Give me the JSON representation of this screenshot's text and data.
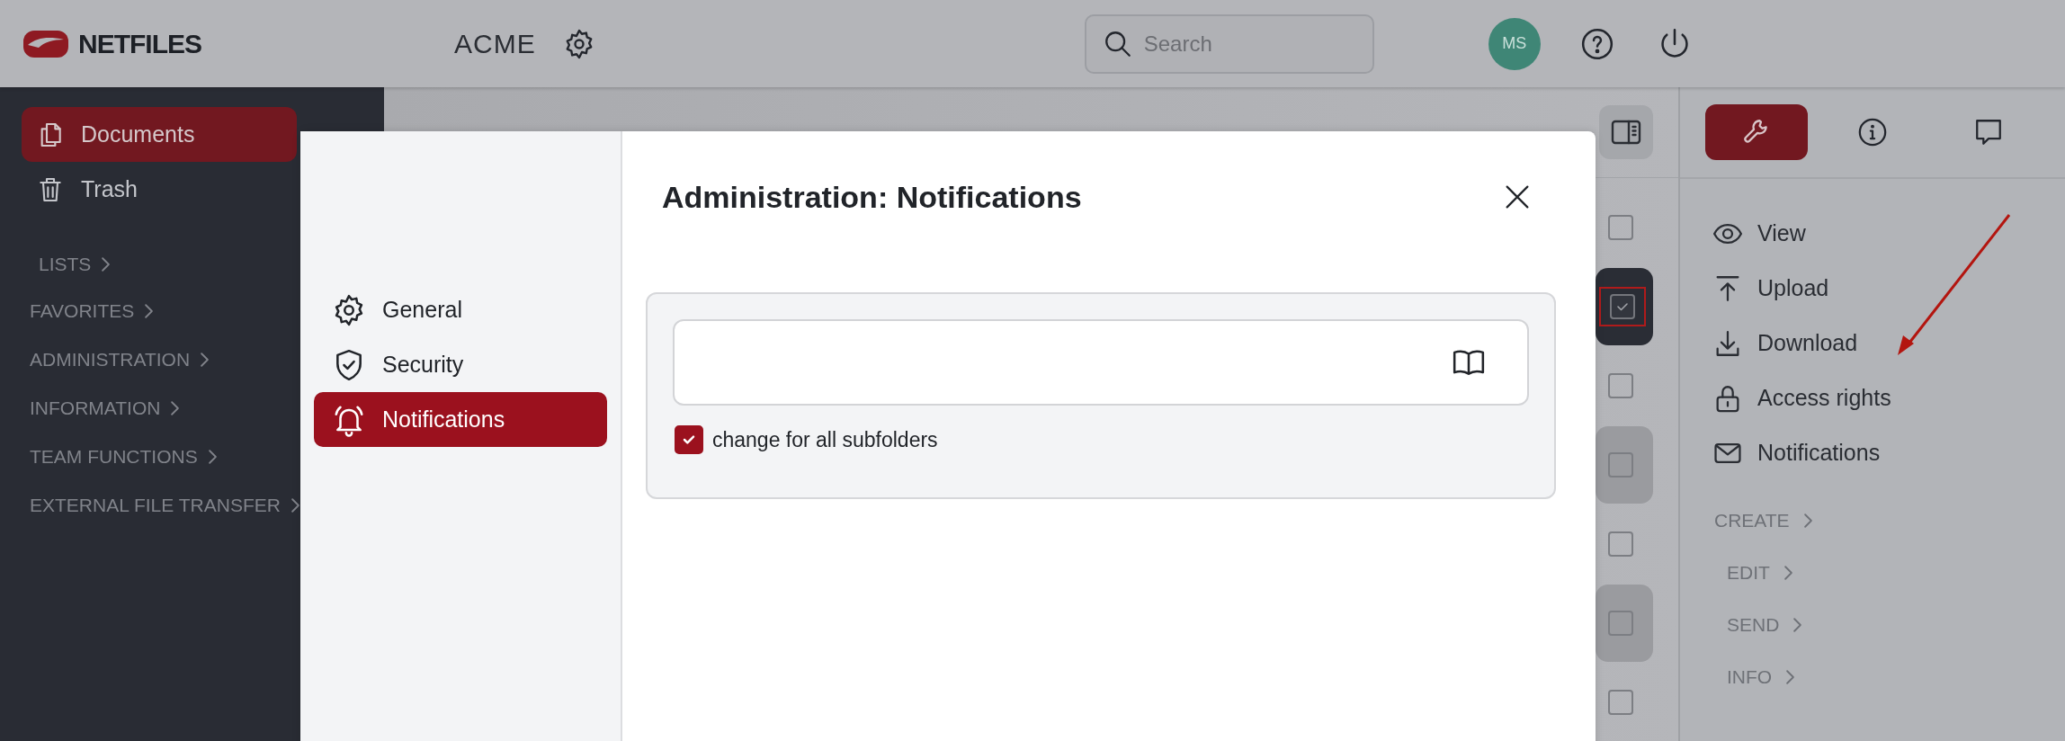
{
  "header": {
    "logo": "NETFILES",
    "workspace": "ACME",
    "search": {
      "placeholder": "Search"
    },
    "avatar": "MS"
  },
  "sidebar": {
    "items": [
      {
        "label": "Documents",
        "selected": true
      },
      {
        "label": "Trash",
        "selected": false
      }
    ],
    "sections": [
      "LISTS",
      "FAVORITES",
      "ADMINISTRATION",
      "INFORMATION",
      "TEAM FUNCTIONS",
      "EXTERNAL FILE TRANSFER"
    ]
  },
  "file_list": {
    "rows": [
      {
        "selected": false,
        "shaded": false,
        "checked": false
      },
      {
        "selected": true,
        "shaded": false,
        "checked": true
      },
      {
        "selected": false,
        "shaded": false,
        "checked": false
      },
      {
        "selected": false,
        "shaded": true,
        "checked": false
      },
      {
        "selected": false,
        "shaded": false,
        "checked": false
      },
      {
        "selected": false,
        "shaded": true,
        "checked": false
      },
      {
        "selected": false,
        "shaded": false,
        "checked": false
      }
    ]
  },
  "panel": {
    "tabs": [
      {
        "selected": true
      },
      {
        "selected": false
      },
      {
        "selected": false
      }
    ],
    "actions": [
      "View",
      "Upload",
      "Download",
      "Access rights",
      "Notifications"
    ],
    "sections": [
      "CREATE",
      "EDIT",
      "SEND",
      "INFO"
    ]
  },
  "modal": {
    "title": "Administration: Notifications",
    "nav": [
      {
        "label": "General",
        "selected": false
      },
      {
        "label": "Security",
        "selected": false
      },
      {
        "label": "Notifications",
        "selected": true
      }
    ],
    "checkbox": {
      "label": "change for all subfolders",
      "checked": true
    }
  }
}
